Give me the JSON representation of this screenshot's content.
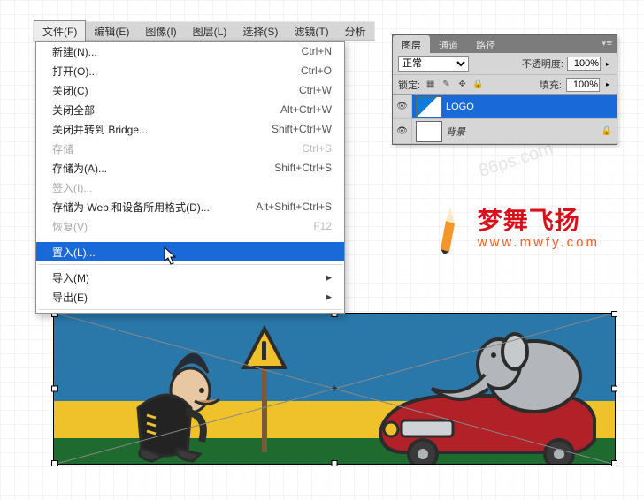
{
  "menu_bar": {
    "items": [
      "文件(F)",
      "编辑(E)",
      "图像(I)",
      "图层(L)",
      "选择(S)",
      "滤镜(T)",
      "分析"
    ]
  },
  "file_menu": {
    "items": [
      {
        "label": "新建(N)...",
        "shortcut": "Ctrl+N",
        "type": "item"
      },
      {
        "label": "打开(O)...",
        "shortcut": "Ctrl+O",
        "type": "item"
      },
      {
        "label": "关闭(C)",
        "shortcut": "Ctrl+W",
        "type": "item"
      },
      {
        "label": "关闭全部",
        "shortcut": "Alt+Ctrl+W",
        "type": "item"
      },
      {
        "label": "关闭并转到 Bridge...",
        "shortcut": "Shift+Ctrl+W",
        "type": "item"
      },
      {
        "label": "存储",
        "shortcut": "Ctrl+S",
        "type": "item",
        "disabled": true
      },
      {
        "label": "存储为(A)...",
        "shortcut": "Shift+Ctrl+S",
        "type": "item"
      },
      {
        "label": "签入(I)...",
        "shortcut": "",
        "type": "item",
        "disabled": true
      },
      {
        "label": "存储为 Web 和设备所用格式(D)...",
        "shortcut": "Alt+Shift+Ctrl+S",
        "type": "item"
      },
      {
        "label": "恢复(V)",
        "shortcut": "F12",
        "type": "item",
        "disabled": true
      },
      {
        "type": "sep"
      },
      {
        "label": "置入(L)...",
        "shortcut": "",
        "type": "item",
        "highlight": true
      },
      {
        "type": "sep"
      },
      {
        "label": "导入(M)",
        "shortcut": "",
        "type": "sub"
      },
      {
        "label": "导出(E)",
        "shortcut": "",
        "type": "sub"
      },
      {
        "type": "sep"
      }
    ]
  },
  "layers_panel": {
    "tabs": [
      "图层",
      "通道",
      "路径"
    ],
    "blend_mode_label": "正常",
    "opacity_label": "不透明度:",
    "opacity_value": "100%",
    "lock_label": "锁定:",
    "fill_label": "填充:",
    "fill_value": "100%",
    "layers": [
      {
        "name": "LOGO",
        "selected": true,
        "locked": false
      },
      {
        "name": "背景",
        "selected": false,
        "locked": true
      }
    ]
  },
  "brand": {
    "name_zh": "梦舞飞扬",
    "url": "www.mwfy.com"
  },
  "watermark": "86ps.com"
}
